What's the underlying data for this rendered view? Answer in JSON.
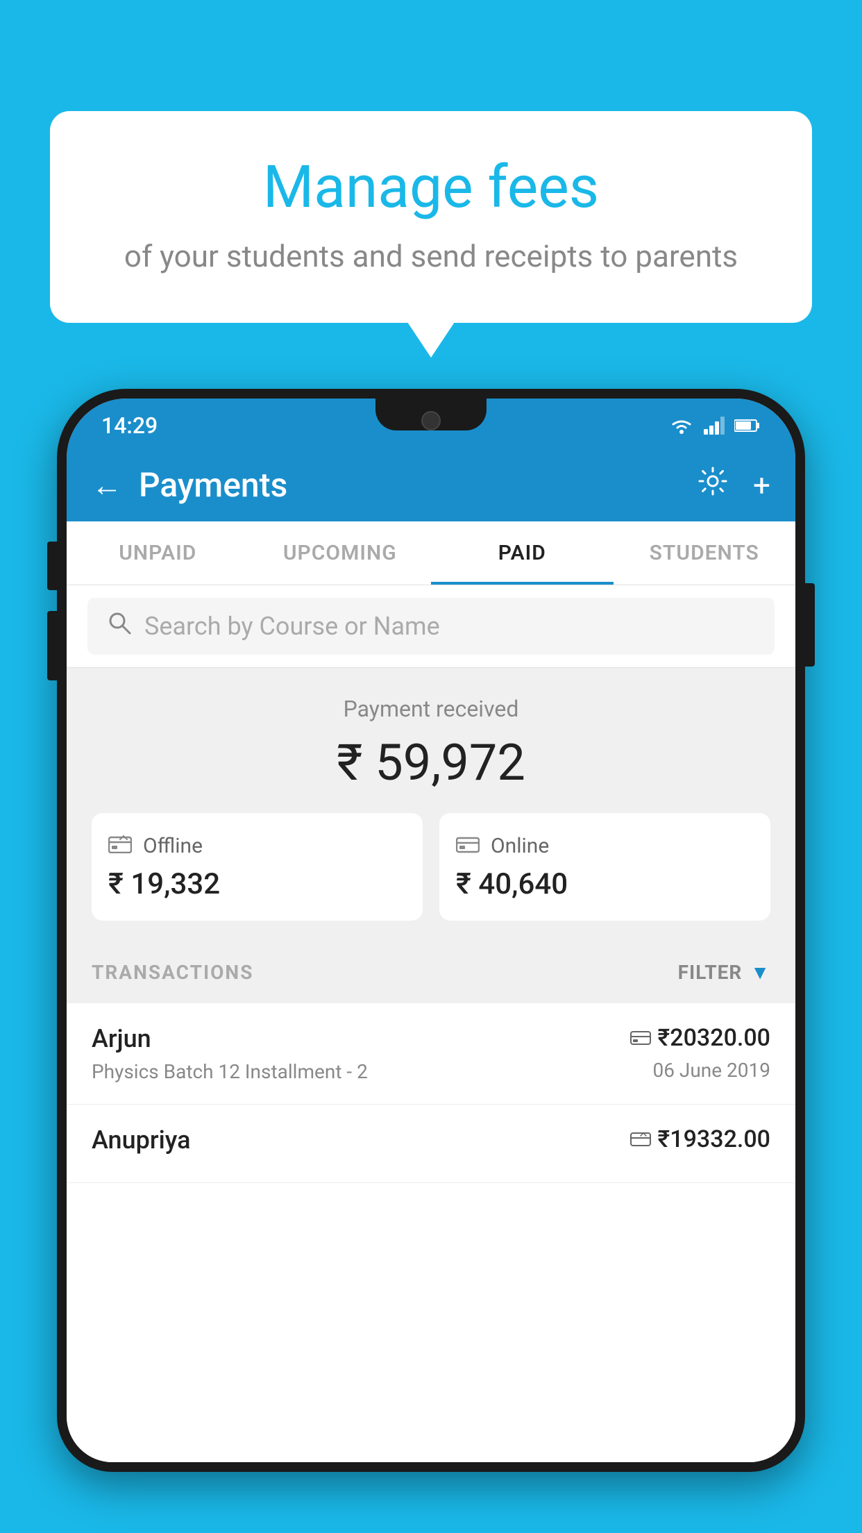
{
  "background_color": "#1ab8e8",
  "bubble": {
    "title": "Manage fees",
    "subtitle": "of your students and send receipts to parents"
  },
  "status_bar": {
    "time": "14:29",
    "wifi": "wifi",
    "signal": "signal",
    "battery": "battery"
  },
  "header": {
    "title": "Payments",
    "back_label": "←",
    "gear_label": "⚙",
    "plus_label": "+"
  },
  "tabs": [
    {
      "label": "UNPAID",
      "active": false
    },
    {
      "label": "UPCOMING",
      "active": false
    },
    {
      "label": "PAID",
      "active": true
    },
    {
      "label": "STUDENTS",
      "active": false
    }
  ],
  "search": {
    "placeholder": "Search by Course or Name"
  },
  "payment_summary": {
    "label": "Payment received",
    "total": "₹ 59,972",
    "offline": {
      "label": "Offline",
      "amount": "₹ 19,332"
    },
    "online": {
      "label": "Online",
      "amount": "₹ 40,640"
    }
  },
  "transactions": {
    "section_label": "TRANSACTIONS",
    "filter_label": "FILTER",
    "items": [
      {
        "name": "Arjun",
        "description": "Physics Batch 12 Installment - 2",
        "amount": "₹20320.00",
        "date": "06 June 2019",
        "method": "online"
      },
      {
        "name": "Anupriya",
        "description": "",
        "amount": "₹19332.00",
        "date": "",
        "method": "offline"
      }
    ]
  }
}
